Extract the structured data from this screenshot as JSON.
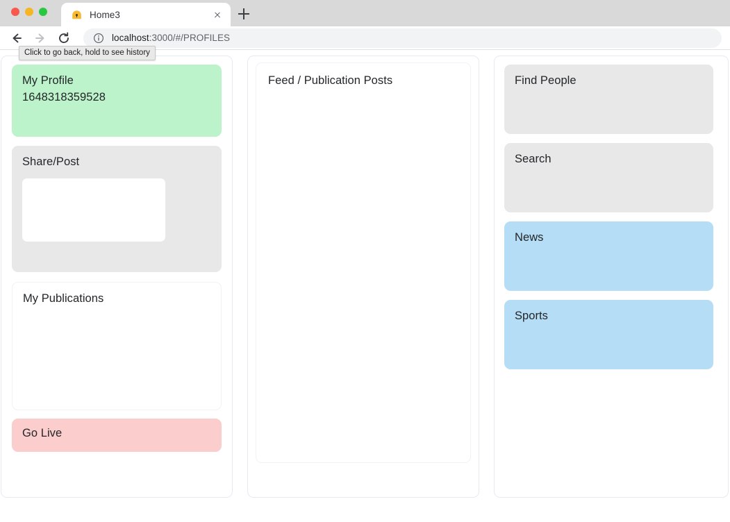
{
  "browser": {
    "window_controls": [
      {
        "name": "close",
        "color": "#f9584d"
      },
      {
        "name": "minimize",
        "color": "#f6b523"
      },
      {
        "name": "maximize",
        "color": "#2ac840"
      }
    ],
    "tab": {
      "title": "Home3",
      "favicon": "dome-favicon",
      "close_icon": "close-icon"
    },
    "new_tab_icon": "plus-icon",
    "nav": {
      "back_icon": "arrow-left-icon",
      "forward_icon": "arrow-right-icon",
      "reload_icon": "reload-icon"
    },
    "omnibox": {
      "info_icon": "info-circle-icon",
      "url_host": "localhost",
      "url_path": ":3000/#/PROFILES",
      "url_full": "localhost:3000/#/PROFILES"
    },
    "tooltip": "Click to go back, hold to see history"
  },
  "colors": {
    "green_card": "#bcf3cb",
    "gray_card": "#e8e8e8",
    "blue_card": "#b5ddf5",
    "pink_card": "#fbcdcd",
    "panel_border": "#e6eaf0",
    "text": "#232629"
  },
  "page": {
    "left_column": {
      "profile_card": {
        "title": "My Profile",
        "user_id": "1648318359528"
      },
      "share_card": {
        "title": "Share/Post",
        "textarea_value": "",
        "textarea_placeholder": ""
      },
      "publications_card": {
        "title": "My Publications"
      },
      "go_live_card": {
        "title": "Go Live"
      }
    },
    "middle_column": {
      "feed_card": {
        "title": "Feed / Publication Posts"
      }
    },
    "right_column": {
      "cards": [
        {
          "title": "Find People",
          "style": "gray"
        },
        {
          "title": "Search",
          "style": "gray"
        },
        {
          "title": "News",
          "style": "blue"
        },
        {
          "title": "Sports",
          "style": "blue"
        }
      ]
    }
  }
}
